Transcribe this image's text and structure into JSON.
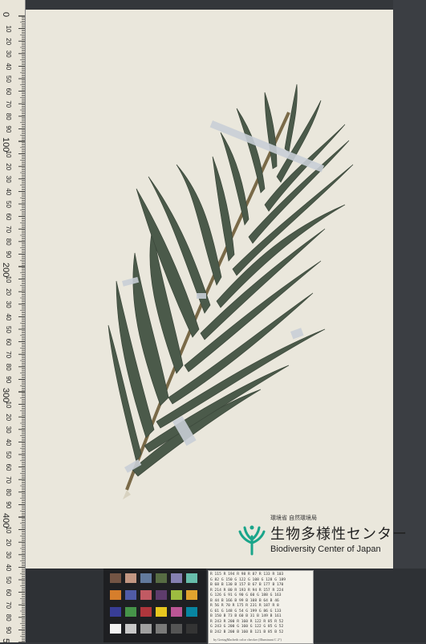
{
  "scene": {
    "kind": "herbarium-specimen-scan",
    "subject": "pressed leafy plant shoot with narrow lanceolate leaves",
    "colors": {
      "paper": "#eae7dc",
      "leaf": "#4b5a4a",
      "stem": "#7a6a48",
      "tape": "#c9cfd6",
      "background": "#34373b"
    }
  },
  "ruler": {
    "major_labels": [
      "0",
      "10",
      "20",
      "30",
      "40",
      "50",
      "60",
      "70",
      "80",
      "90",
      "100",
      "10",
      "20",
      "30",
      "40",
      "50",
      "60",
      "70",
      "80",
      "90",
      "200",
      "10",
      "20",
      "30",
      "40",
      "50",
      "60",
      "70",
      "80",
      "90",
      "300",
      "10",
      "20",
      "30",
      "40",
      "50",
      "60",
      "70",
      "80",
      "90",
      "400",
      "10",
      "20",
      "30",
      "40",
      "50",
      "60",
      "70",
      "80",
      "90",
      "500"
    ]
  },
  "logo": {
    "agency": "環境省 自然環境局",
    "name_jp": "生物多様性センター",
    "name_en": "Biodiversity Center of Japan"
  },
  "color_table": {
    "rows": [
      "R 115  R 194  R  98  R  87  R 133  R 103",
      "G  82  G 150  G 122  G 108  G 128  G 189",
      "B  68  B 130  B 157  B  67  B 177  B 170",
      "R 214  R  80  R 193  R  94  R 157  R 224",
      "G 126  G  91  G  90  G  60  G 188  G 163",
      "B  44  B 166  B  99  B 108  B  64  B  46",
      "R  56  R  70  R 175  R 231  R 187  R   8",
      "G  61  G 148  G  54  G 199  G  86  G 133",
      "B 150  B  73  B  60  B  31  B 149  B 161",
      "R 243  R 200  R 160  R 122  R  85  R  52",
      "G 243  G 200  G 160  G 122  G  85  G  52",
      "B 242  B 200  B 160  B 121  B  85  B  52"
    ],
    "caption": "by GretagMacbeth color checker (Illuminant C 2°)"
  }
}
